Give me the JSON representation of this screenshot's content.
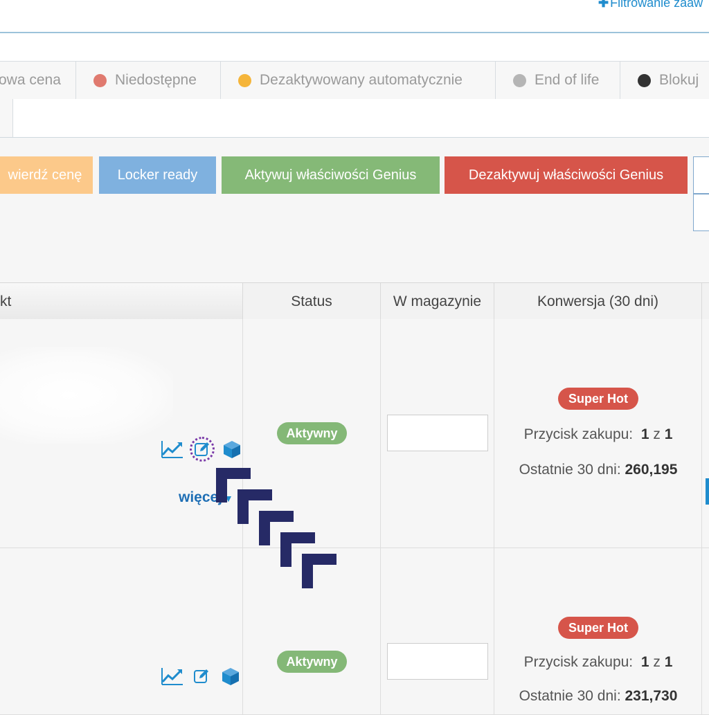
{
  "header": {
    "filter_link": "Filtrowanie zaaw"
  },
  "legend": {
    "items": [
      {
        "label": "owa cena",
        "color": ""
      },
      {
        "label": "Niedostępne",
        "color": "#e07a6f"
      },
      {
        "label": "Dezaktywowany automatycznie",
        "color": "#f5b53a"
      },
      {
        "label": "End of life",
        "color": "#b5b5b5"
      },
      {
        "label": "Blokuj",
        "color": "#333333"
      }
    ]
  },
  "actions": {
    "confirm_price": "wierdź cenę",
    "locker_ready": "Locker ready",
    "activate_genius": "Aktywuj właściwości Genius",
    "deactivate_genius": "Dezaktywuj właściwości Genius"
  },
  "table": {
    "columns": [
      "kt",
      "Status",
      "W magazynie",
      "Konwersja (30 dni)"
    ],
    "rows": [
      {
        "status": "Aktywny",
        "badge": "Super Hot",
        "buybox_label": "Przycisk zakupu:",
        "buybox_value": "1",
        "buybox_sep": "z",
        "buybox_total": "1",
        "last30_label": "Ostatnie 30 dni:",
        "last30_value": "260,195",
        "more": "więcej"
      },
      {
        "status": "Aktywny",
        "badge": "Super Hot",
        "buybox_label": "Przycisk zakupu:",
        "buybox_value": "1",
        "buybox_sep": "z",
        "buybox_total": "1",
        "last30_label": "Ostatnie 30 dni:",
        "last30_value": "231,730"
      }
    ]
  },
  "icons": {
    "chart": "chart-icon",
    "edit": "edit-icon",
    "box": "box-icon",
    "cursor": "drag-cursor-icon"
  }
}
